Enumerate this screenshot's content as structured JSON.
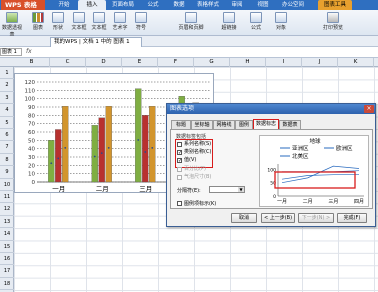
{
  "app": {
    "name": "WPS 表格",
    "ribbon_tabs": [
      {
        "label": "开始"
      },
      {
        "label": "插入"
      },
      {
        "label": "页面布局"
      },
      {
        "label": "公式"
      },
      {
        "label": "数据"
      },
      {
        "label": "表格样式"
      },
      {
        "label": "审阅"
      },
      {
        "label": "视图"
      },
      {
        "label": "办公空间"
      },
      {
        "label": "图表工具"
      }
    ]
  },
  "toolbar": {
    "tools": [
      {
        "label": "数据透视表"
      },
      {
        "label": "图表"
      },
      {
        "label": "形状"
      },
      {
        "label": "文本框"
      },
      {
        "label": "文本框"
      },
      {
        "label": "艺术字"
      },
      {
        "label": "符号"
      },
      {
        "label": "页眉和页脚"
      },
      {
        "label": "超链接"
      },
      {
        "label": "公式"
      },
      {
        "label": "对象"
      },
      {
        "label": "打印预览"
      }
    ]
  },
  "document": {
    "tab_label": "我的WPS | 文档 1 中的 图表 1",
    "name_box": "图表 1",
    "fx": "fx"
  },
  "sheet": {
    "columns": [
      "B",
      "C",
      "D",
      "E",
      "F",
      "G",
      "H",
      "I",
      "J",
      "K"
    ],
    "rows": [
      "1",
      "2",
      "3",
      "4",
      "5",
      "6",
      "7",
      "8",
      "9",
      "10",
      "11",
      "12",
      "13",
      "14",
      "15",
      "16",
      "17",
      "18"
    ]
  },
  "chart_data": {
    "type": "bar",
    "categories": [
      "一月",
      "二月",
      "三月",
      "四月"
    ],
    "series": [
      {
        "name": "亚洲区",
        "values": [
          50,
          68,
          112,
          103
        ],
        "color": "#7fae42"
      },
      {
        "name": "欧洲区",
        "values": [
          63,
          77,
          80,
          80
        ],
        "color": "#b8312f"
      },
      {
        "name": "北美区",
        "values": [
          91,
          91,
          91,
          95
        ],
        "color": "#d2952d"
      }
    ],
    "yticks": [
      0,
      10,
      20,
      30,
      40,
      50,
      60,
      70,
      80,
      90,
      100,
      110,
      120
    ],
    "ylim": [
      0,
      120
    ],
    "grid": true
  },
  "dialog": {
    "title": "图表选项",
    "close": "×",
    "tabs": [
      {
        "label": "标题"
      },
      {
        "label": "坐标轴"
      },
      {
        "label": "网格线"
      },
      {
        "label": "图例"
      },
      {
        "label": "数据标志"
      },
      {
        "label": "数据表"
      }
    ],
    "group_label": "数据标签包括",
    "checkboxes": [
      {
        "label": "系列名称(S)",
        "checked": false
      },
      {
        "label": "类别名称(C)",
        "checked": true
      },
      {
        "label": "值(V)",
        "checked": true
      },
      {
        "label": "百分比(P)",
        "checked": false
      },
      {
        "label": "气泡尺寸(B)",
        "checked": false
      }
    ],
    "separator_label": "分隔符(E):",
    "legend_key_label": "图例项标示(K)",
    "preview_title": "地球",
    "buttons": [
      {
        "label": "取消"
      },
      {
        "label": "< 上一步(B)"
      },
      {
        "label": "下一步(N) >"
      },
      {
        "label": "完成(F)"
      }
    ]
  }
}
